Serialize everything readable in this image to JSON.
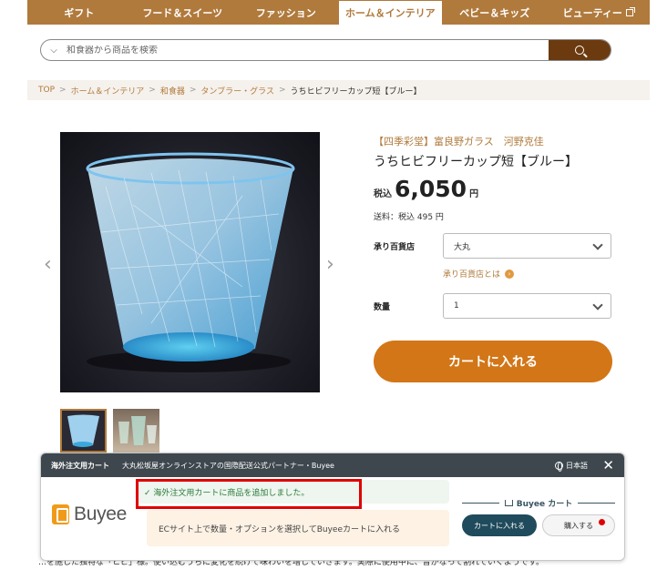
{
  "nav": {
    "items": [
      {
        "label": "ギフト",
        "active": false
      },
      {
        "label": "フード＆スイーツ",
        "active": false
      },
      {
        "label": "ファッション",
        "active": false
      },
      {
        "label": "ホーム＆インテリア",
        "active": true
      },
      {
        "label": "ベビー＆キッズ",
        "active": false
      },
      {
        "label": "ビューティー",
        "active": false
      }
    ]
  },
  "search": {
    "placeholder": "和食器から商品を検索"
  },
  "breadcrumb": [
    "TOP",
    "ホーム＆インテリア",
    "和食器",
    "タンブラー・グラス",
    "うちヒビフリーカップ短【ブルー】"
  ],
  "product": {
    "brand": "【四季彩堂】富良野ガラス　河野克佳",
    "name": "うちヒビフリーカップ短【ブルー】",
    "price_prefix": "税込",
    "price": "6,050",
    "price_unit": "円",
    "shipping": "送料：税込 495 円",
    "store_label": "承り百貨店",
    "store_value": "大丸",
    "store_help": "承り百貨店とは",
    "qty_label": "数量",
    "qty_value": "1",
    "cart_button": "カートに入れる"
  },
  "gallery": {
    "prev": "‹",
    "next": "›"
  },
  "behind_text": "…を施した独特な「ヒビ」様。使い込むうちに変化を続けて味わいを増していきます。実際に使用中に、音がなって割れていくようです。",
  "buyee": {
    "header_title": "海外注文用カート",
    "header_sub": "大丸松坂屋オンラインストアの国際配送公式パートナー・Buyee",
    "language": "日本語",
    "close": "✕",
    "logo": "Buyee",
    "notice": "✓ 海外注文用カートに商品を追加しました。",
    "info": "ECサイト上で数量・オプションを選択してBuyeeカートに入れる",
    "cart_heading": "Buyee カート",
    "add_button": "カートに入れる",
    "buy_button": "購入する"
  }
}
